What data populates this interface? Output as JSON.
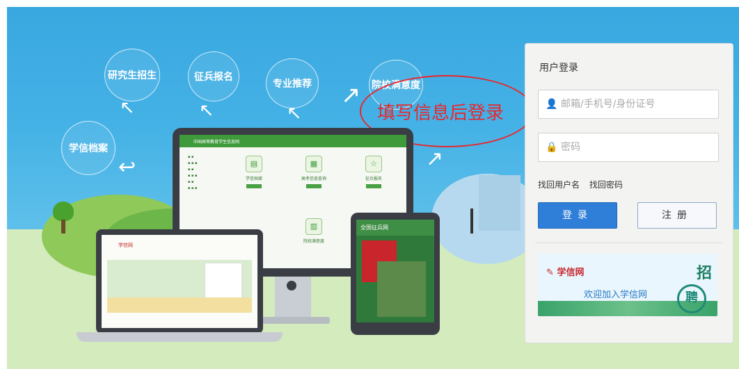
{
  "hero": {
    "bubbles": {
      "grad_recruit": "研究生招生",
      "conscription": "征兵报名",
      "major_recommend": "专业推荐",
      "school_ranking": "院校满意度",
      "records": "学信档案"
    },
    "annotation": "填写信息后登录"
  },
  "monitor": {
    "site_title": "中国高等教育学生信息网",
    "tiles": [
      {
        "title": "学信档案",
        "icon": "document-icon"
      },
      {
        "title": "高考信息查询",
        "icon": "chart-icon"
      },
      {
        "title": "征兵报名",
        "icon": "star-icon"
      },
      {
        "title": "院校满意度",
        "icon": "building-icon"
      }
    ]
  },
  "laptop": {
    "site_title": "学信网"
  },
  "tablet": {
    "title": "全国征兵网"
  },
  "login": {
    "title": "用户登录",
    "username_placeholder": "邮箱/手机号/身份证号",
    "password_placeholder": "密码",
    "find_username": "找回用户名",
    "find_password": "找回密码",
    "login_button": "登录",
    "register_button": "注册",
    "banner": {
      "logo": "学信网",
      "slogan": "欢迎加入学信网",
      "zhao": "招",
      "pin": "聘"
    }
  },
  "colors": {
    "sky": "#39a8e0",
    "login_blue": "#2f7fd8",
    "annotation_red": "#e8272d",
    "site_green": "#3f9a3c"
  }
}
